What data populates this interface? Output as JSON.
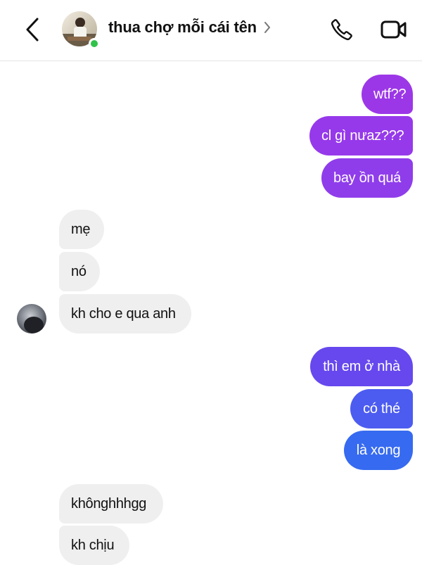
{
  "header": {
    "contact_name": "thua chợ mỗi cái tên",
    "icons": {
      "back": "chevron-left-icon",
      "profile_chevron": "chevron-right-icon",
      "call": "phone-icon",
      "video": "video-camera-icon"
    },
    "online_status_color": "#31c24a"
  },
  "messages": [
    {
      "sender": "me",
      "text": "wtf??"
    },
    {
      "sender": "me",
      "text": "cl gì nưaz???"
    },
    {
      "sender": "me",
      "text": "bay ồn quá"
    },
    {
      "sender": "contact",
      "text": "mẹ"
    },
    {
      "sender": "contact",
      "text": "nó"
    },
    {
      "sender": "contact",
      "text": "kh cho e qua anh"
    },
    {
      "sender": "me",
      "text": "thì em ở nhà"
    },
    {
      "sender": "me",
      "text": "có thé"
    },
    {
      "sender": "me",
      "text": "là xong"
    },
    {
      "sender": "contact",
      "text": "khônghhhgg"
    },
    {
      "sender": "contact",
      "text": "kh chịu"
    }
  ],
  "colors": {
    "outgoing_gradient_top": "#9b36e8",
    "outgoing_gradient_bottom": "#2d6ef0",
    "incoming_bubble": "#efefef"
  }
}
